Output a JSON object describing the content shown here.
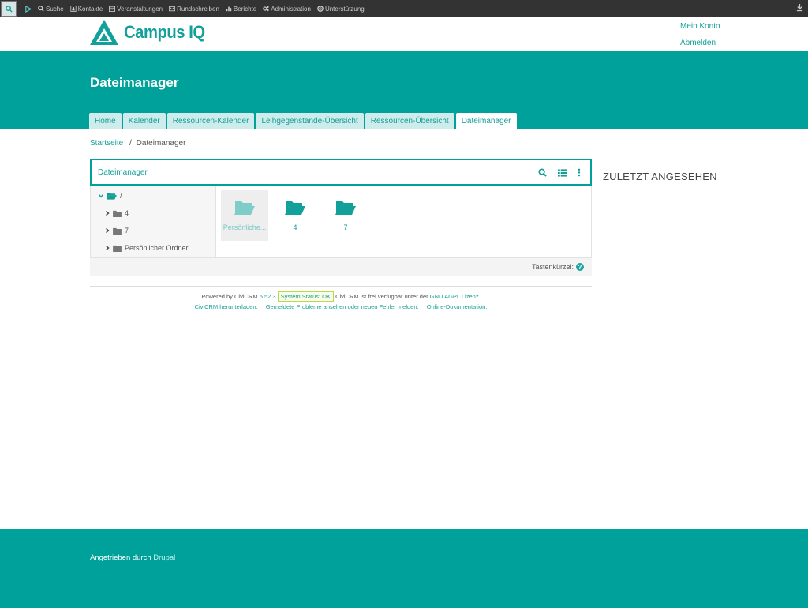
{
  "menubar": {
    "items": [
      {
        "label": "Suche",
        "icon": "search-icon"
      },
      {
        "label": "Kontakte",
        "icon": "contact-card-icon"
      },
      {
        "label": "Veranstaltungen",
        "icon": "calendar-icon"
      },
      {
        "label": "Rundschreiben",
        "icon": "envelope-icon"
      },
      {
        "label": "Berichte",
        "icon": "bar-chart-icon"
      },
      {
        "label": "Administration",
        "icon": "gears-icon"
      },
      {
        "label": "Unterstützung",
        "icon": "life-ring-icon"
      }
    ]
  },
  "header": {
    "brand": "Campus IQ",
    "account_link": "Mein Konto",
    "logout_link": "Abmelden"
  },
  "page": {
    "title": "Dateimanager",
    "tabs": [
      {
        "label": "Home",
        "active": false
      },
      {
        "label": "Kalender",
        "active": false
      },
      {
        "label": "Ressourcen-Kalender",
        "active": false
      },
      {
        "label": "Leihgegenstände-Übersicht",
        "active": false
      },
      {
        "label": "Ressourcen-Übersicht",
        "active": false
      },
      {
        "label": "Dateimanager",
        "active": true
      }
    ]
  },
  "breadcrumb": {
    "home": "Startseite",
    "separator": "/",
    "current": "Dateimanager"
  },
  "filemanager": {
    "title": "Dateimanager",
    "tree": {
      "root": "/",
      "children": [
        "4",
        "7",
        "Persönlicher Ordner"
      ]
    },
    "files": [
      {
        "label": "Persönlicher Ordner",
        "display": "Persönliche...",
        "selected": true
      },
      {
        "label": "4",
        "display": "4",
        "selected": false
      },
      {
        "label": "7",
        "display": "7",
        "selected": false
      }
    ],
    "shortcuts_label": "Tastenkürzel:",
    "help_glyph": "?"
  },
  "sidebar": {
    "recent_title": "ZULETZT ANGESEHEN"
  },
  "civi_footer": {
    "powered_by": "Powered by CiviCRM",
    "version": "5.52.3",
    "status": "System Status: OK",
    "license_text": "CiviCRM ist frei verfügbar unter der",
    "license_link": "GNU AGPL Lizenz",
    "download_link": "CiviCRM herunterladen.",
    "issues_link": "Gemeldete Probleme ansehen oder neuen Fehler melden.",
    "docs_link": "Online-Dokumentation."
  },
  "site_footer": {
    "text": "Angetrieben durch",
    "link": "Drupal"
  },
  "colors": {
    "brand_teal": "#00a19a",
    "link_teal": "#139e97",
    "menubar_bg": "#333333"
  }
}
